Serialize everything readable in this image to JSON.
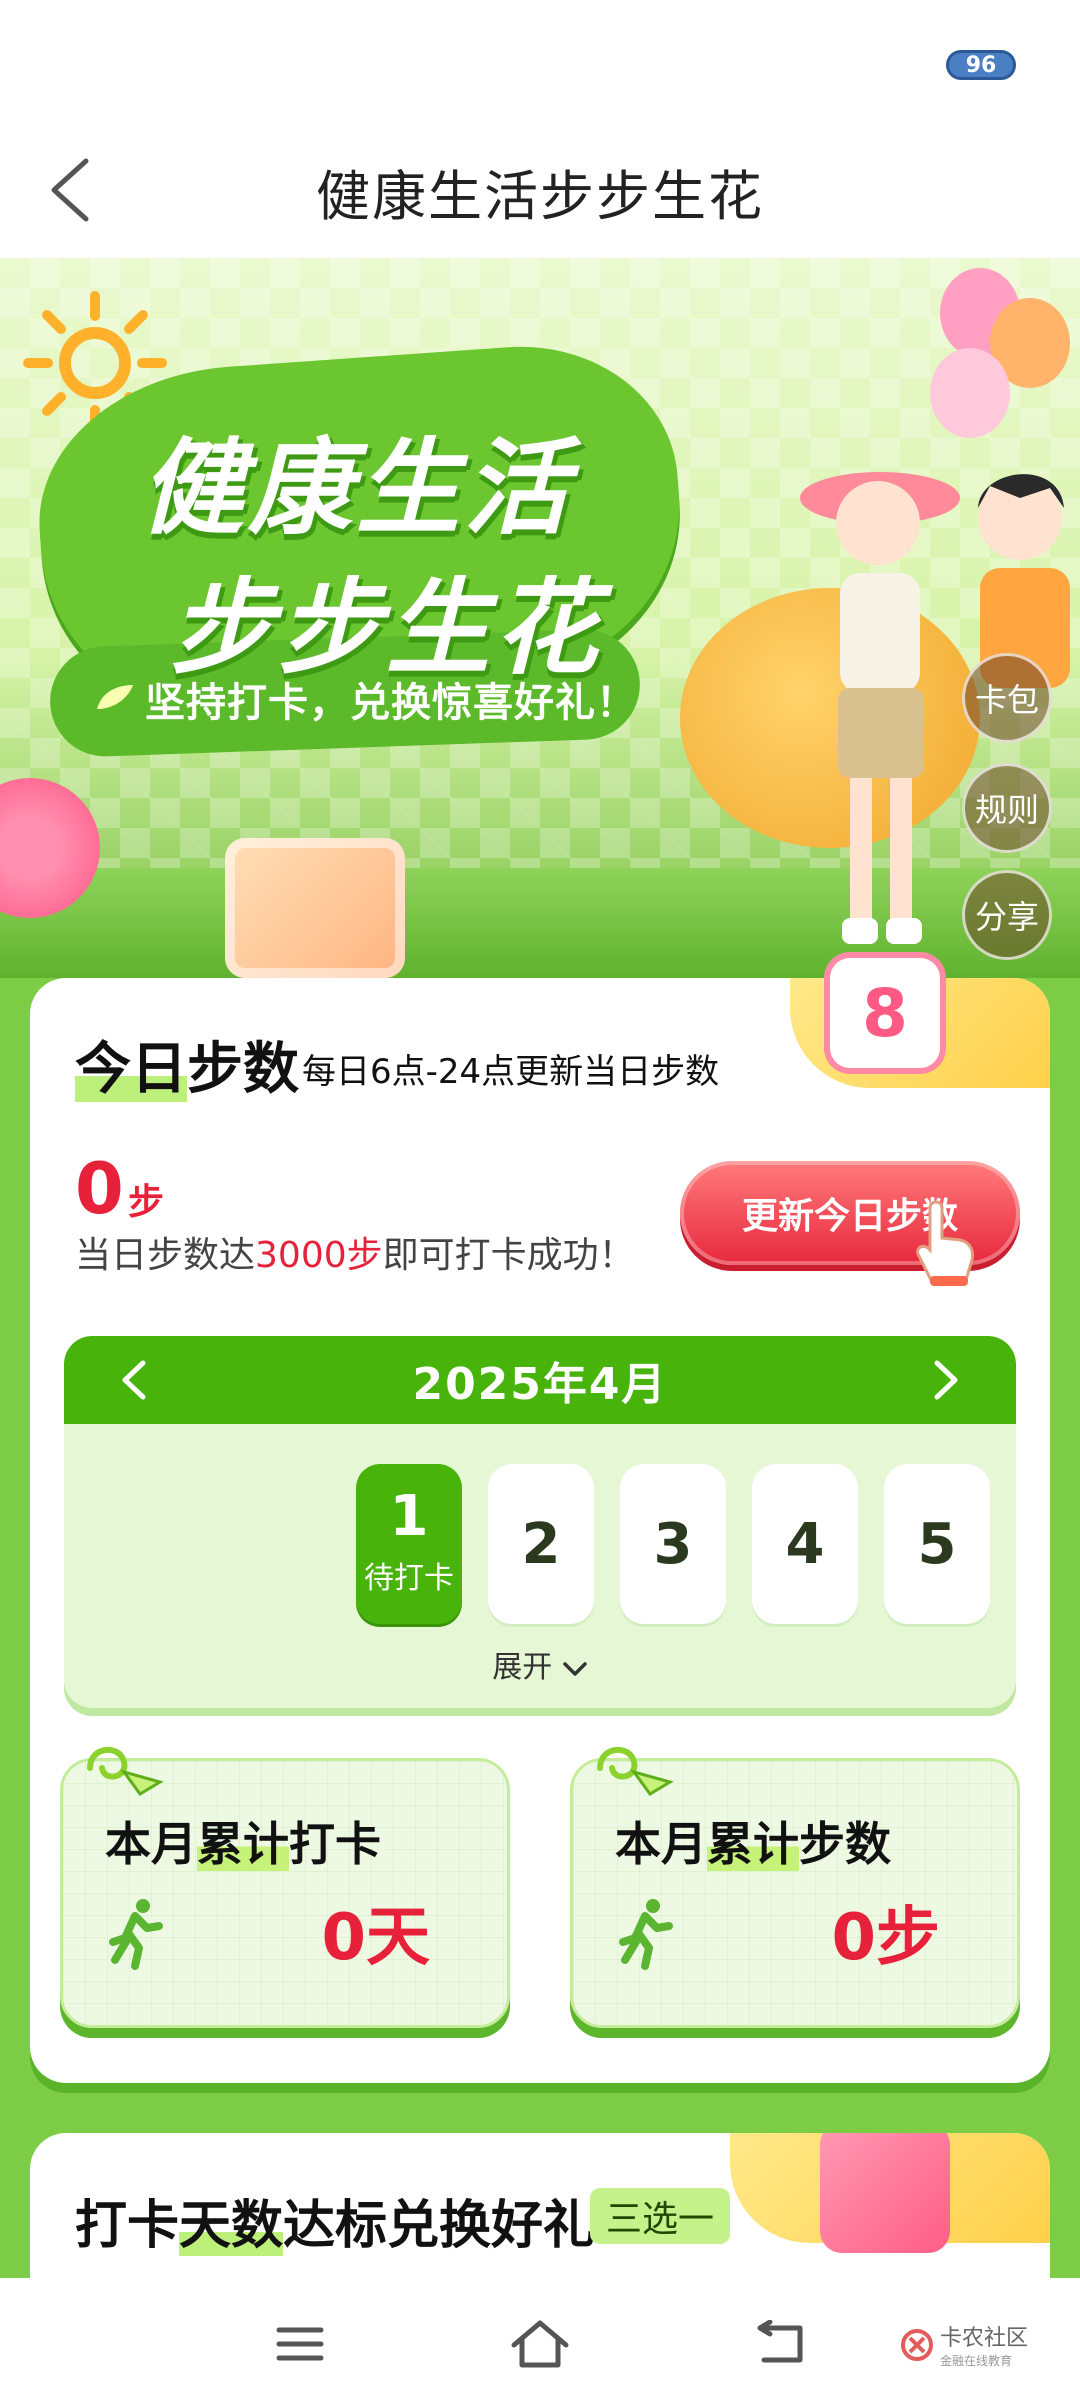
{
  "status_bar": {
    "battery": "96"
  },
  "header": {
    "title": "健康生活步步生花"
  },
  "banner": {
    "hero_line1": "健康生活",
    "hero_line2": "步步生花",
    "slogan": "坚持打卡，兑换惊喜好礼！",
    "side_buttons": [
      "卡包",
      "规则",
      "分享"
    ]
  },
  "today": {
    "title_highlight": "今日",
    "title_rest": "步数",
    "subtitle": "每日6点-24点更新当日步数",
    "steps_value": "0",
    "steps_unit": "步",
    "goal_prefix": "当日步数达",
    "goal_target": "3000步",
    "goal_suffix": "即可打卡成功！",
    "update_button": "更新今日步数",
    "calendar_badge": "8"
  },
  "calendar": {
    "month": "2025年4月",
    "days": [
      {
        "num": "1",
        "status": "待打卡",
        "active": true
      },
      {
        "num": "2",
        "status": "",
        "active": false
      },
      {
        "num": "3",
        "status": "",
        "active": false
      },
      {
        "num": "4",
        "status": "",
        "active": false
      },
      {
        "num": "5",
        "status": "",
        "active": false
      }
    ],
    "expand_label": "展开"
  },
  "stats": [
    {
      "title_a": "本月",
      "title_b": "累计",
      "title_c": "打卡",
      "value": "0天"
    },
    {
      "title_a": "本月",
      "title_b": "累计",
      "title_c": "步数",
      "value": "0步"
    }
  ],
  "redeem": {
    "title_a": "打卡",
    "title_b": "天数",
    "title_c": "达标兑换好礼",
    "tag": "三选一"
  },
  "watermark": {
    "name": "卡农社区",
    "sub": "金融在线教育"
  },
  "colors": {
    "accent_green": "#48b40b",
    "accent_red": "#e8213a",
    "bg_green": "#7ccc45"
  }
}
